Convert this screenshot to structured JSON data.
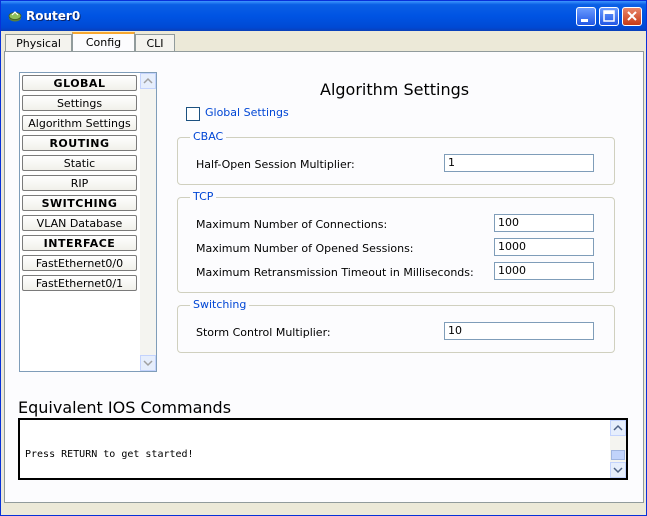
{
  "window": {
    "title": "Router0"
  },
  "tabs": [
    {
      "label": "Physical"
    },
    {
      "label": "Config"
    },
    {
      "label": "CLI"
    }
  ],
  "sidebar": {
    "items": [
      {
        "label": "GLOBAL"
      },
      {
        "label": "Settings"
      },
      {
        "label": "Algorithm Settings"
      },
      {
        "label": "ROUTING"
      },
      {
        "label": "Static"
      },
      {
        "label": "RIP"
      },
      {
        "label": "SWITCHING"
      },
      {
        "label": "VLAN Database"
      },
      {
        "label": "INTERFACE"
      },
      {
        "label": "FastEthernet0/0"
      },
      {
        "label": "FastEthernet0/1"
      }
    ]
  },
  "main": {
    "heading": "Algorithm Settings",
    "global_settings": {
      "label": "Global Settings",
      "checked": false
    },
    "cbac": {
      "legend": "CBAC",
      "half_open_label": "Half-Open Session Multiplier:",
      "half_open_value": "1"
    },
    "tcp": {
      "legend": "TCP",
      "max_connections_label": "Maximum Number of Connections:",
      "max_connections_value": "100",
      "max_sessions_label": "Maximum Number of Opened Sessions:",
      "max_sessions_value": "1000",
      "max_timeout_label": "Maximum Retransmission Timeout in Milliseconds:",
      "max_timeout_value": "1000"
    },
    "switching": {
      "legend": "Switching",
      "storm_label": "Storm Control Multiplier:",
      "storm_value": "10"
    }
  },
  "ios": {
    "title": "Equivalent IOS Commands",
    "console_text": "Press RETURN to get started!"
  },
  "colors": {
    "titlebar": "#0054E3",
    "legend": "#0046D5",
    "tab_accent": "#F7A730"
  }
}
